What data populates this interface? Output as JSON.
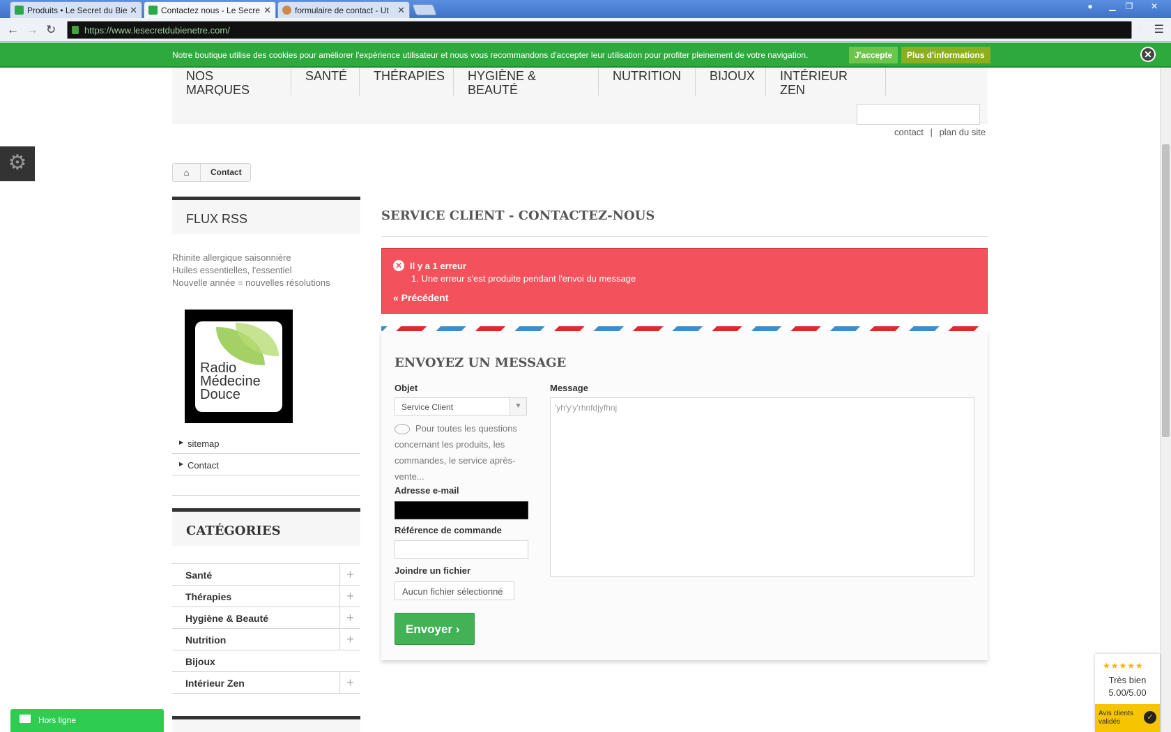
{
  "browser": {
    "tabs": [
      {
        "label": "Produits • Le Secret du Bie"
      },
      {
        "label": "Contactez nous - Le Secre"
      },
      {
        "label": "formulaire de contact - Ut"
      }
    ],
    "close_glyph": "✕",
    "url": "https://www.lesecretdubienetre.com/"
  },
  "cookie": {
    "message": "Notre boutique utilise des cookies pour améliorer l'expérience utilisateur et nous vous recommandons d'accepter leur utilisation pour profiter pleinement de votre navigation.",
    "accept": "J'accepte",
    "more": "Plus d'informations",
    "close": "✕"
  },
  "nav": {
    "items": [
      "NOS MARQUES",
      "SANTÉ",
      "THÉRAPIES",
      "HYGIÈNE & BEAUTÉ",
      "NUTRITION",
      "BIJOUX",
      "INTÉRIEUR ZEN"
    ]
  },
  "header_links": {
    "contact": "contact",
    "separator": "|",
    "sitemap": "plan du site"
  },
  "breadcrumb": {
    "current": "Contact"
  },
  "sidebar": {
    "rss_title": "FLUX RSS",
    "rss_items": [
      "Rhinite allergique saisonnière",
      "Huiles essentielles, l'essentiel",
      "Nouvelle année = nouvelles résolutions"
    ],
    "radio_logo_text": [
      "Radio",
      "Médecine",
      "Douce"
    ],
    "links": [
      "sitemap",
      "Contact"
    ],
    "categories_title": "CATÉGORIES",
    "categories": [
      "Santé",
      "Thérapies",
      "Hygiène & Beauté",
      "Nutrition",
      "Bijoux",
      "Intérieur Zen"
    ],
    "plus": "+"
  },
  "chat": {
    "label": "Hors ligne"
  },
  "main": {
    "heading": "SERVICE CLIENT - CONTACTEZ-NOUS",
    "error_title": "Il y a 1 erreur",
    "error_line": "1. Une erreur s'est produite pendant l'envoi du message",
    "back": "« Précédent",
    "form_title": "ENVOYEZ UN MESSAGE",
    "subject_label": "Objet",
    "subject_value": "Service Client",
    "subject_help": "Pour toutes les questions concernant les produits, les commandes, le service après-vente...",
    "email_label": "Adresse e-mail",
    "order_ref_label": "Référence de commande",
    "file_label": "Joindre un fichier",
    "file_value": "Aucun fichier sélectionné",
    "message_label": "Message",
    "message_value": "'yh'y'y'rhnfdjyfhnj",
    "send": "Envoyer"
  },
  "review": {
    "stars": "★★★★★",
    "label": "Très bien",
    "score": "5.00/5.00",
    "footer": "Avis clients validés",
    "rating": 5
  },
  "colors": {
    "cookie_green": "#2ea93e",
    "error_red": "#f3515c",
    "send_green": "#43b155"
  }
}
